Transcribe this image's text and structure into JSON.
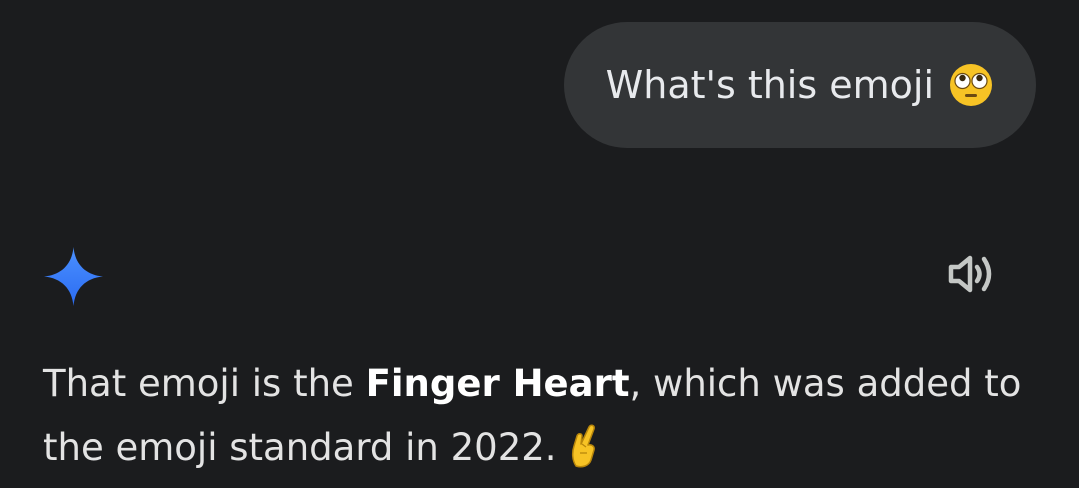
{
  "user_message": {
    "text": "What's this emoji",
    "emoji_icon": "flushed-face-emoji"
  },
  "assistant": {
    "avatar_icon": "gemini-sparkle-icon",
    "speaker_icon": "speaker-icon",
    "response_before": "That emoji is the ",
    "response_bold": "Finger Heart",
    "response_after": ", which was added to the emoji standard in 2022.",
    "response_emoji_icon": "hand-with-index-finger-and-thumb-crossed-emoji"
  },
  "colors": {
    "background": "#1b1c1e",
    "bubble": "#333537",
    "text": "#e3e3e3",
    "sparkle_top": "#4b90ff",
    "sparkle_bottom": "#2b6cf2",
    "speaker": "#c4c7c5"
  }
}
